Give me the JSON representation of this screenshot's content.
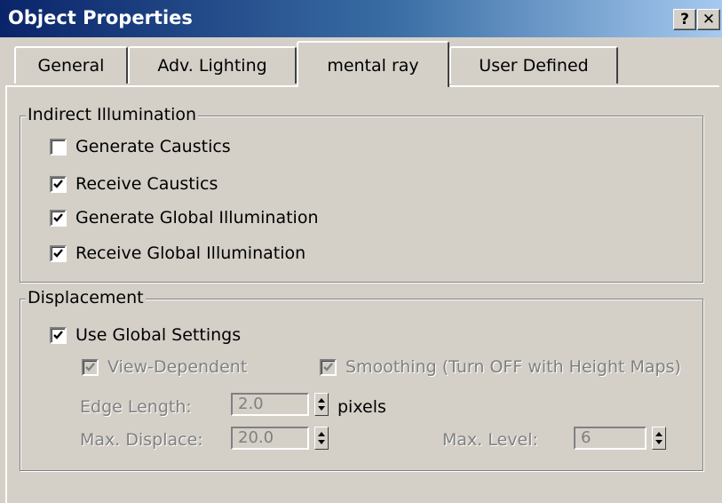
{
  "window": {
    "title": "Object Properties",
    "help_label": "?",
    "close_label": "✕"
  },
  "tabs": [
    {
      "label": "General",
      "active": false
    },
    {
      "label": "Adv. Lighting",
      "active": false
    },
    {
      "label": "mental ray",
      "active": true
    },
    {
      "label": "User Defined",
      "active": false
    }
  ],
  "indirect": {
    "legend": "Indirect Illumination",
    "items": [
      {
        "label": "Generate Caustics",
        "checked": false
      },
      {
        "label": "Receive Caustics",
        "checked": true
      },
      {
        "label": "Generate Global Illumination",
        "checked": true
      },
      {
        "label": "Receive Global Illumination",
        "checked": true
      }
    ]
  },
  "displacement": {
    "legend": "Displacement",
    "use_global": {
      "label": "Use Global Settings",
      "checked": true
    },
    "view_dependent": {
      "label": "View-Dependent",
      "checked": true,
      "enabled": false
    },
    "smoothing": {
      "label": "Smoothing (Turn OFF with Height Maps)",
      "checked": true,
      "enabled": false
    },
    "edge_length": {
      "label": "Edge Length:",
      "value": "2.0",
      "unit": "pixels"
    },
    "max_displace": {
      "label": "Max. Displace:",
      "value": "20.0"
    },
    "max_level": {
      "label": "Max. Level:",
      "value": "6"
    }
  }
}
